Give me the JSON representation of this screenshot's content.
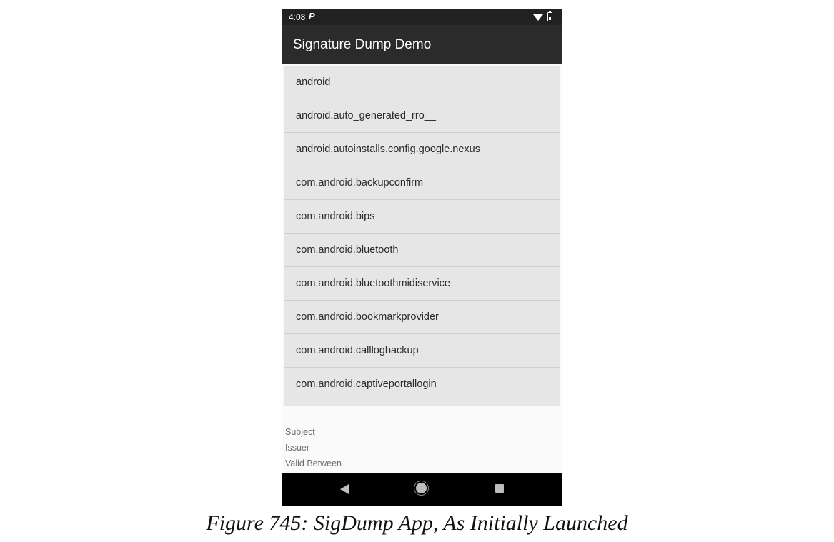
{
  "status_bar": {
    "time": "4:08",
    "notification_icon": "P"
  },
  "app_bar": {
    "title": "Signature Dump Demo"
  },
  "packages": [
    "android",
    "android.auto_generated_rro__",
    "android.autoinstalls.config.google.nexus",
    "com.android.backupconfirm",
    "com.android.bips",
    "com.android.bluetooth",
    "com.android.bluetoothmidiservice",
    "com.android.bookmarkprovider",
    "com.android.calllogbackup",
    "com.android.captiveportallogin"
  ],
  "details": {
    "subject": "Subject",
    "issuer": "Issuer",
    "valid_between": "Valid Between"
  },
  "caption": "Figure 745: SigDump App, As Initially Launched",
  "icons": {
    "wifi": "wifi-icon",
    "battery": "battery-icon",
    "back": "back-icon",
    "home": "home-icon",
    "recents": "recents-icon"
  },
  "colors": {
    "app_bar": "#2b2b2b",
    "status_bar": "#212121",
    "list_background": "#e6e6e6",
    "nav_bar": "#000000"
  }
}
